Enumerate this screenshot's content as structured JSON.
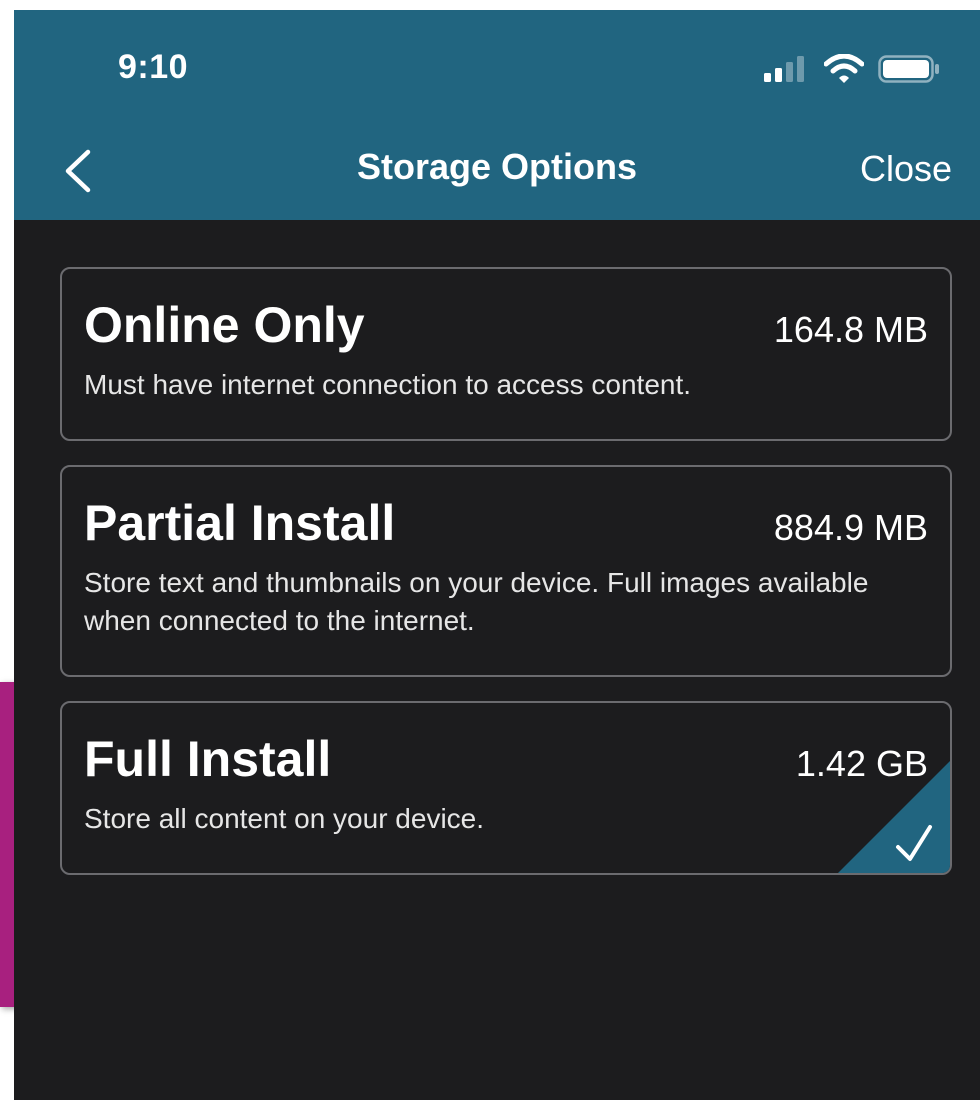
{
  "status_bar": {
    "time": "9:10",
    "icons": [
      "cellular-signal-icon",
      "wifi-icon",
      "battery-icon"
    ]
  },
  "nav": {
    "back_icon": "chevron-left-icon",
    "title": "Storage Options",
    "close_label": "Close"
  },
  "options": [
    {
      "title": "Online Only",
      "size": "164.8 MB",
      "description": "Must have internet connection to access content.",
      "selected": false
    },
    {
      "title": "Partial Install",
      "size": "884.9 MB",
      "description": "Store text and thumbnails on your device. Full images available when connected to the internet.",
      "selected": false
    },
    {
      "title": "Full Install",
      "size": "1.42 GB",
      "description": "Store all content on your device.",
      "selected": true
    }
  ],
  "colors": {
    "header_bg": "#216580",
    "screen_bg": "#1c1c1e",
    "accent": "#216580",
    "side_tab": "#a8207f"
  }
}
